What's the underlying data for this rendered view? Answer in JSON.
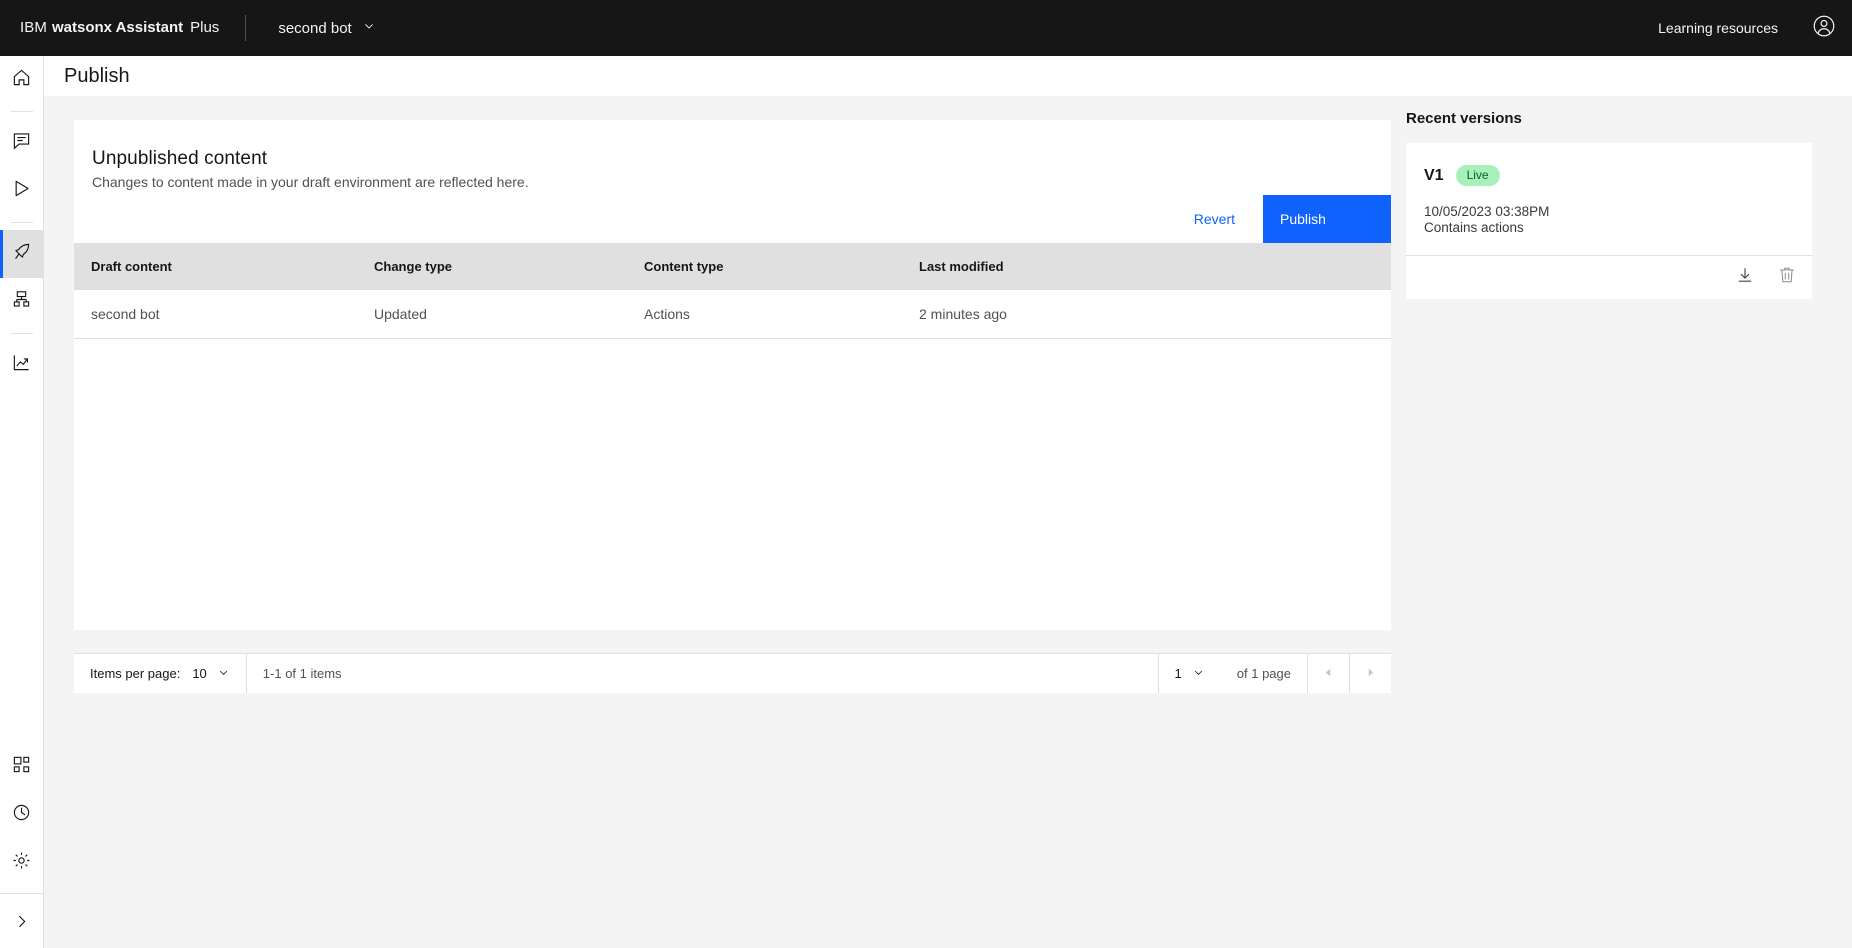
{
  "header": {
    "brand_ibm": "IBM",
    "brand_product": "watsonx Assistant",
    "brand_plan": "Plus",
    "bot_name": "second bot",
    "learning_resources": "Learning resources",
    "account_icon": "user-avatar-icon",
    "chevron_icon": "chevron-down-icon",
    "background": "#161616"
  },
  "rail": {
    "items": [
      {
        "name": "home",
        "icon": "home-icon",
        "active": false
      },
      {
        "name": "assistants",
        "icon": "chat-icon",
        "active": false
      },
      {
        "name": "preview",
        "icon": "play-icon",
        "active": false
      },
      {
        "name": "publish",
        "icon": "rocket-icon",
        "active": true
      },
      {
        "name": "integrations",
        "icon": "integrations-icon",
        "active": false
      },
      {
        "name": "analytics",
        "icon": "analytics-icon",
        "active": false
      },
      {
        "name": "apps",
        "icon": "apps-grid-icon",
        "active": false
      },
      {
        "name": "history",
        "icon": "clock-icon",
        "active": false
      },
      {
        "name": "settings",
        "icon": "gear-icon",
        "active": false
      },
      {
        "name": "expand",
        "icon": "chevron-right-icon",
        "active": false
      }
    ],
    "active_indicator_color": "#0f62fe",
    "active_background": "#e0e0e0"
  },
  "page": {
    "title": "Publish"
  },
  "unpublished": {
    "title": "Unpublished content",
    "subtitle": "Changes to content made in your draft environment are reflected here.",
    "revert_label": "Revert",
    "publish_label": "Publish",
    "publish_color": "#0f62fe",
    "revert_color": "#0f62fe",
    "columns": [
      "Draft content",
      "Change type",
      "Content type",
      "Last modified"
    ],
    "rows": [
      {
        "draft_content": "second bot",
        "change_type": "Updated",
        "content_type": "Actions",
        "last_modified": "2 minutes ago"
      }
    ]
  },
  "pagination": {
    "items_per_page_label": "Items per page:",
    "items_per_page_value": "10",
    "range_text": "1-1 of 1 items",
    "page_value": "1",
    "page_of_text": "of 1 page",
    "prev_icon": "caret-left-icon",
    "next_icon": "caret-right-icon"
  },
  "recent_versions": {
    "title": "Recent versions",
    "versions": [
      {
        "name": "V1",
        "tag": "Live",
        "tag_bg": "#a7f0ba",
        "tag_color": "#0e6027",
        "date": "10/05/2023 03:38PM",
        "meta": "Contains actions",
        "download_icon": "download-icon",
        "delete_icon": "trash-icon"
      }
    ]
  }
}
